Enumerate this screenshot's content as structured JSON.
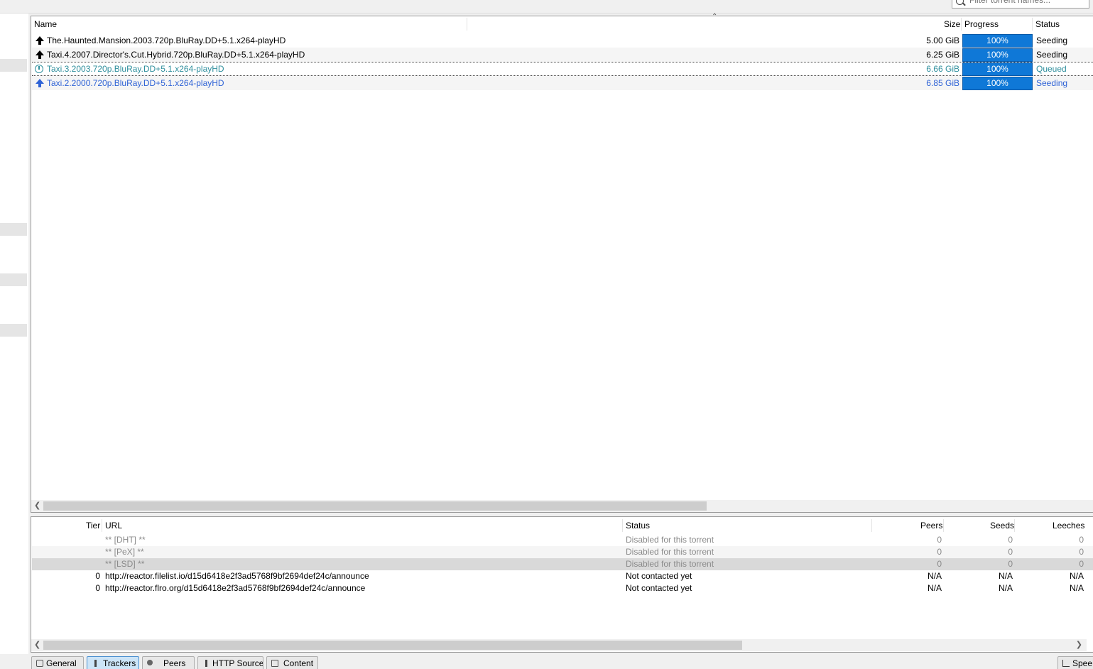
{
  "filter": {
    "placeholder": "Filter torrent names..."
  },
  "torrent_list": {
    "columns": {
      "name": "Name",
      "size": "Size",
      "progress": "Progress",
      "status": "Status"
    },
    "rows": [
      {
        "name": "The.Haunted.Mansion.2003.720p.BluRay.DD+5.1.x264-playHD",
        "size": "5.00 GiB",
        "progress": "100%",
        "progress_value": 1.0,
        "status": "Seeding",
        "icon": "upload-arrow-icon"
      },
      {
        "name": "Taxi.4.2007.Director's.Cut.Hybrid.720p.BluRay.DD+5.1.x264-playHD",
        "size": "6.25 GiB",
        "progress": "100%",
        "progress_value": 1.0,
        "status": "Seeding",
        "icon": "upload-arrow-icon"
      },
      {
        "name": "Taxi.3.2003.720p.BluRay.DD+5.1.x264-playHD",
        "size": "6.66 GiB",
        "progress": "100%",
        "progress_value": 1.0,
        "status": "Queued",
        "icon": "clock-icon"
      },
      {
        "name": "Taxi.2.2000.720p.BluRay.DD+5.1.x264-playHD",
        "size": "6.85 GiB",
        "progress": "100%",
        "progress_value": 1.0,
        "status": "Seeding",
        "icon": "upload-arrow-icon"
      }
    ]
  },
  "trackers": {
    "columns": {
      "tier": "Tier",
      "url": "URL",
      "status": "Status",
      "peers": "Peers",
      "seeds": "Seeds",
      "leeches": "Leeches"
    },
    "rows": [
      {
        "tier": "",
        "url": "** [DHT] **",
        "status": "Disabled for this torrent",
        "peers": "0",
        "seeds": "0",
        "leeches": "0"
      },
      {
        "tier": "",
        "url": "** [PeX] **",
        "status": "Disabled for this torrent",
        "peers": "0",
        "seeds": "0",
        "leeches": "0"
      },
      {
        "tier": "",
        "url": "** [LSD] **",
        "status": "Disabled for this torrent",
        "peers": "0",
        "seeds": "0",
        "leeches": "0"
      },
      {
        "tier": "0",
        "url": "http://reactor.filelist.io/d15d6418e2f3ad5768f9bf2694def24c/announce",
        "status": "Not contacted yet",
        "peers": "N/A",
        "seeds": "N/A",
        "leeches": "N/A"
      },
      {
        "tier": "0",
        "url": "http://reactor.flro.org/d15d6418e2f3ad5768f9bf2694def24c/announce",
        "status": "Not contacted yet",
        "peers": "N/A",
        "seeds": "N/A",
        "leeches": "N/A"
      }
    ]
  },
  "tabs": [
    {
      "label": "General",
      "icon": "general-icon",
      "active": false
    },
    {
      "label": "Trackers",
      "icon": "trackers-icon",
      "active": true
    },
    {
      "label": "Peers",
      "icon": "peers-icon",
      "active": false
    },
    {
      "label": "HTTP Sources",
      "icon": "http-sources-icon",
      "active": false
    },
    {
      "label": "Content",
      "icon": "content-folder-icon",
      "active": false
    }
  ],
  "speed_tab": {
    "label": "Spee",
    "icon": "speed-chart-icon"
  },
  "colors": {
    "progress": "#0f78d7",
    "queued": "#2f8f9d",
    "selected_blue": "#2f63d6"
  }
}
